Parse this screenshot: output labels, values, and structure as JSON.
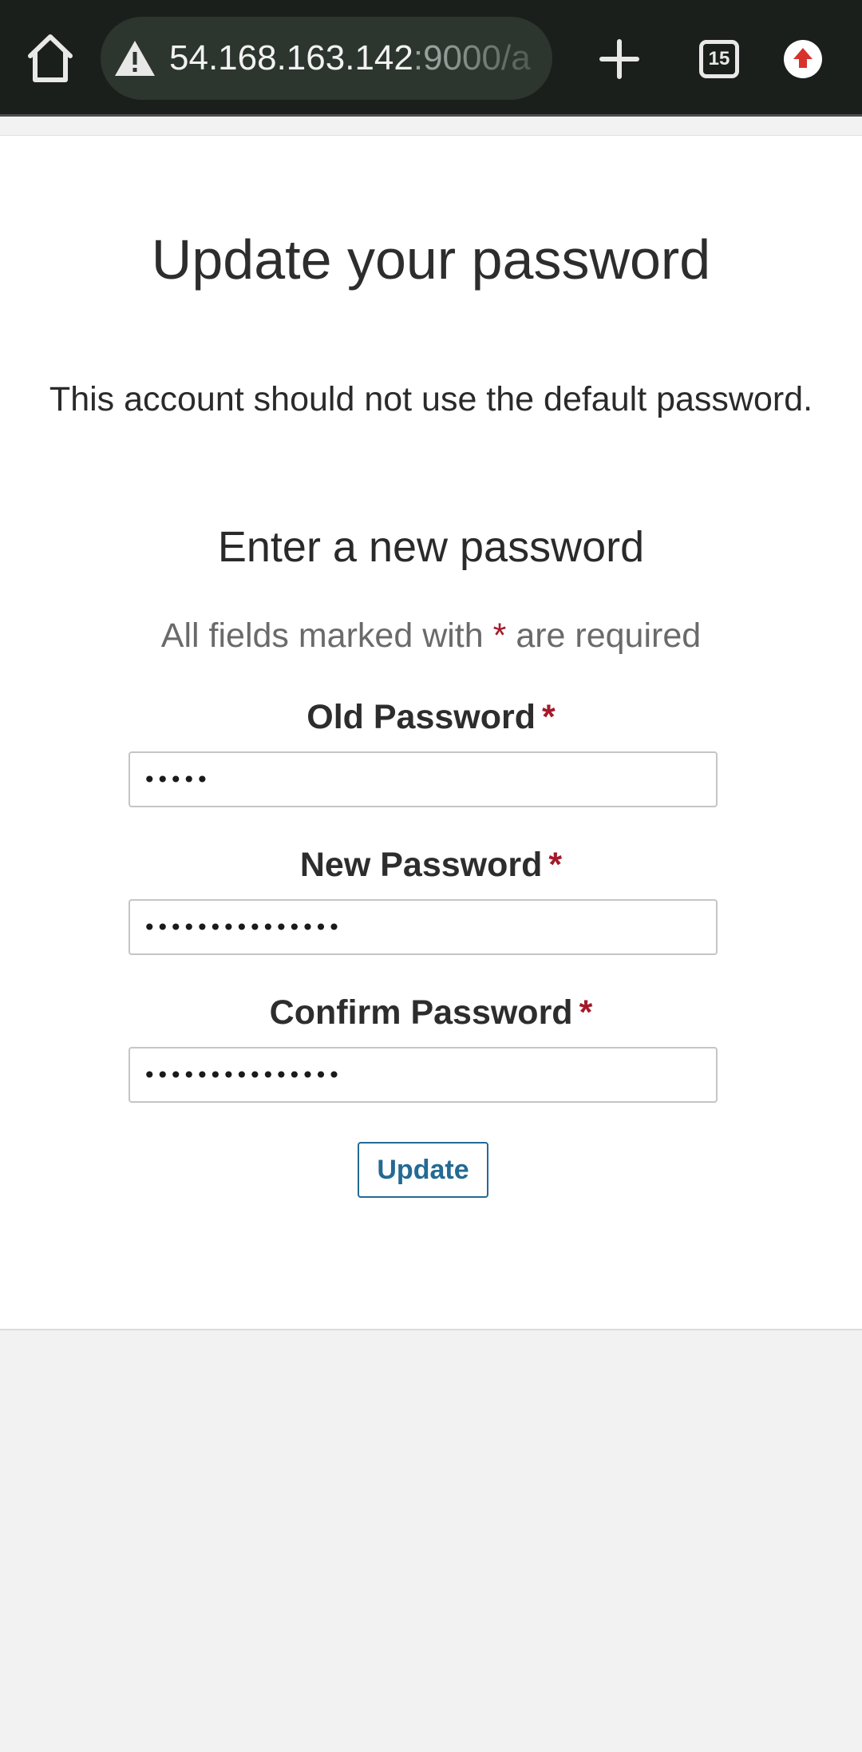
{
  "browser": {
    "url_host": "54.168.163.142",
    "url_rest": ":9000/a",
    "tab_count": "15",
    "icons": {
      "home": "home-icon",
      "warning": "warning-icon",
      "new_tab": "plus-icon",
      "tabs": "tab-switcher-icon",
      "profile": "update-arrow-icon"
    }
  },
  "page": {
    "title": "Update your password",
    "info": "This account should not use the default password."
  },
  "form": {
    "heading": "Enter a new password",
    "required_note_prefix": "All fields marked with",
    "required_marker": "*",
    "required_note_suffix": "are required",
    "fields": [
      {
        "label": "Old Password",
        "value": "•••••",
        "type": "password"
      },
      {
        "label": "New Password",
        "value": "•••••••••••••••",
        "type": "password"
      },
      {
        "label": "Confirm Password",
        "value": "•••••••••••••••",
        "type": "password"
      }
    ],
    "submit_label": "Update"
  },
  "colors": {
    "toolbar": "#1b1f1c",
    "url_pill": "#2d352f",
    "required": "#a4192a",
    "button": "#236a94",
    "update_badge": "#d8332b"
  }
}
